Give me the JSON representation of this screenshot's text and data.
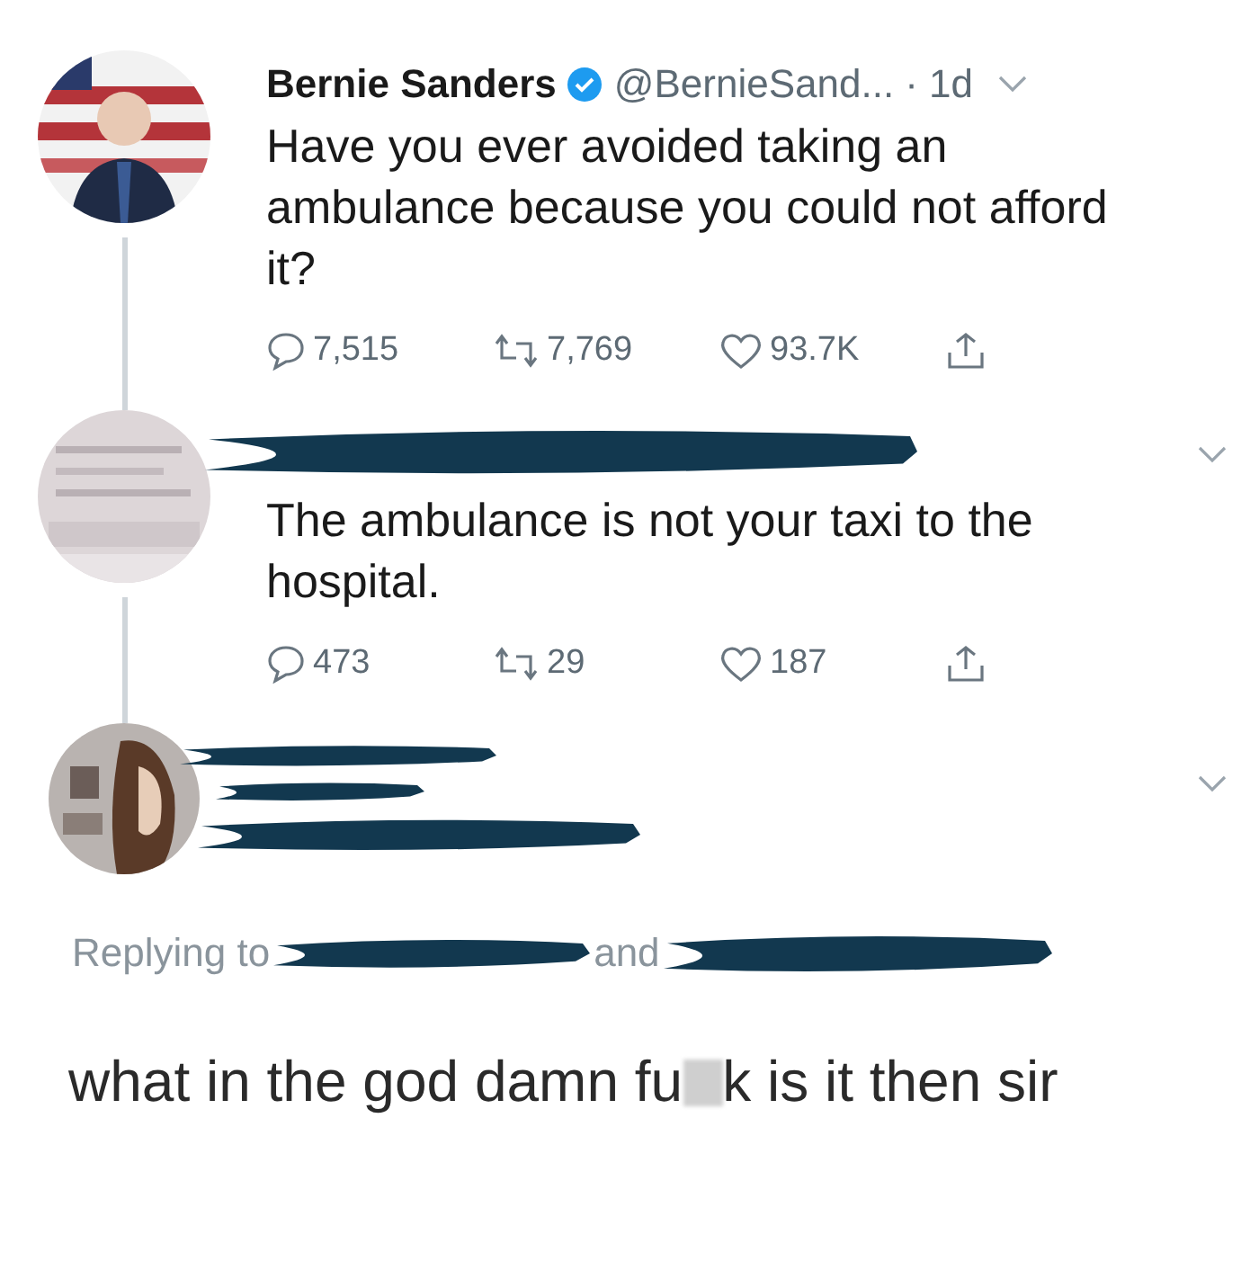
{
  "tweets": [
    {
      "kind": "full",
      "name": "Bernie Sanders",
      "verified": true,
      "handle": "@BernieSand...",
      "time": "· 1d",
      "lines": [
        "Have you ever avoided taking an",
        "ambulance because you could not afford",
        "it?"
      ],
      "replies": "7,515",
      "retweets": "7,769",
      "likes": "93.7K",
      "thread_line": true
    },
    {
      "kind": "redacted",
      "lines": [
        "The ambulance is not your taxi to the",
        "hospital."
      ],
      "replies": "473",
      "retweets": "29",
      "likes": "187",
      "thread_line": true
    },
    {
      "kind": "redacted_header"
    }
  ],
  "replying": {
    "label": "Replying to",
    "joiner": "and"
  },
  "reply_text": {
    "before": "what in the god damn fu",
    "after": "k is it then sir"
  }
}
